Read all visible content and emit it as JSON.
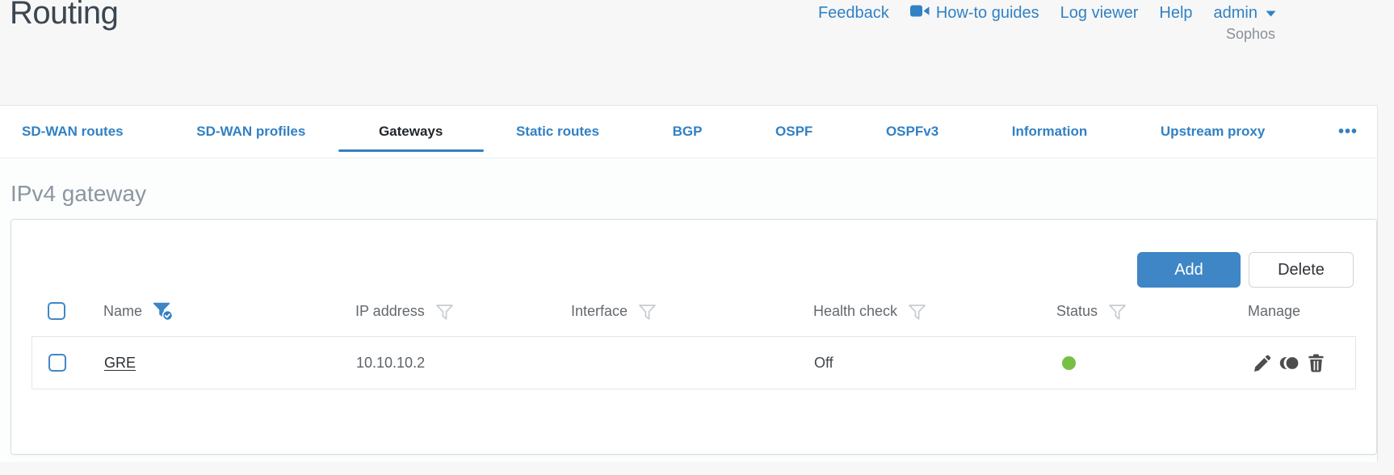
{
  "page": {
    "title": "Routing",
    "brand": "Sophos"
  },
  "top_nav": {
    "feedback": "Feedback",
    "howto_guides": "How-to guides",
    "log_viewer": "Log viewer",
    "help": "Help",
    "account": "admin"
  },
  "tabs": {
    "items": [
      {
        "label": "SD-WAN routes"
      },
      {
        "label": "SD-WAN profiles"
      },
      {
        "label": "Gateways"
      },
      {
        "label": "Static routes"
      },
      {
        "label": "BGP"
      },
      {
        "label": "OSPF"
      },
      {
        "label": "OSPFv3"
      },
      {
        "label": "Information"
      },
      {
        "label": "Upstream proxy"
      }
    ],
    "active": "Gateways",
    "overflow": "•••"
  },
  "section": {
    "heading": "IPv4 gateway"
  },
  "toolbar": {
    "add": "Add",
    "delete": "Delete"
  },
  "table": {
    "columns": [
      {
        "label": "Name",
        "filter": "active"
      },
      {
        "label": "IP address",
        "filter": "inactive"
      },
      {
        "label": "Interface",
        "filter": "inactive"
      },
      {
        "label": "Health check",
        "filter": "inactive"
      },
      {
        "label": "Status",
        "filter": "inactive"
      },
      {
        "label": "Manage",
        "filter": "none"
      }
    ],
    "rows": [
      {
        "name": "GRE",
        "ip_address": "10.10.10.2",
        "interface": "",
        "health_check": "Off",
        "status": "green"
      }
    ]
  },
  "colors": {
    "accent_blue": "#3181c4",
    "button_blue": "#3f86c6",
    "status_green": "#76c143"
  }
}
